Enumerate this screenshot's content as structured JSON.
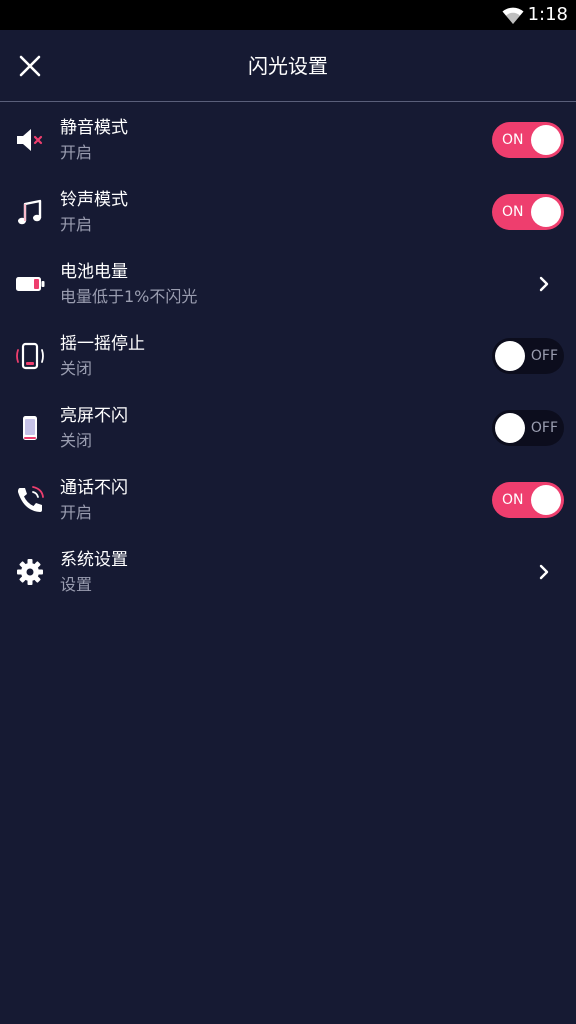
{
  "status_bar": {
    "time": "1:18"
  },
  "header": {
    "title": "闪光设置"
  },
  "colors": {
    "accent": "#ee3e6e",
    "background": "#161a33",
    "subtitle": "#9a9db0",
    "toggle_off": "#0c0d1d"
  },
  "items": [
    {
      "icon": "speaker-mute-icon",
      "title": "静音模式",
      "subtitle": "开启",
      "control": "toggle",
      "state": "ON"
    },
    {
      "icon": "music-note-icon",
      "title": "铃声模式",
      "subtitle": "开启",
      "control": "toggle",
      "state": "ON"
    },
    {
      "icon": "battery-icon",
      "title": "电池电量",
      "subtitle": "电量低于1%不闪光",
      "control": "chevron"
    },
    {
      "icon": "phone-shake-icon",
      "title": "摇一摇停止",
      "subtitle": "关闭",
      "control": "toggle",
      "state": "OFF"
    },
    {
      "icon": "phone-screen-icon",
      "title": "亮屏不闪",
      "subtitle": "关闭",
      "control": "toggle",
      "state": "OFF"
    },
    {
      "icon": "phone-call-icon",
      "title": "通话不闪",
      "subtitle": "开启",
      "control": "toggle",
      "state": "ON"
    },
    {
      "icon": "gear-icon",
      "title": "系统设置",
      "subtitle": "设置",
      "control": "chevron"
    }
  ]
}
